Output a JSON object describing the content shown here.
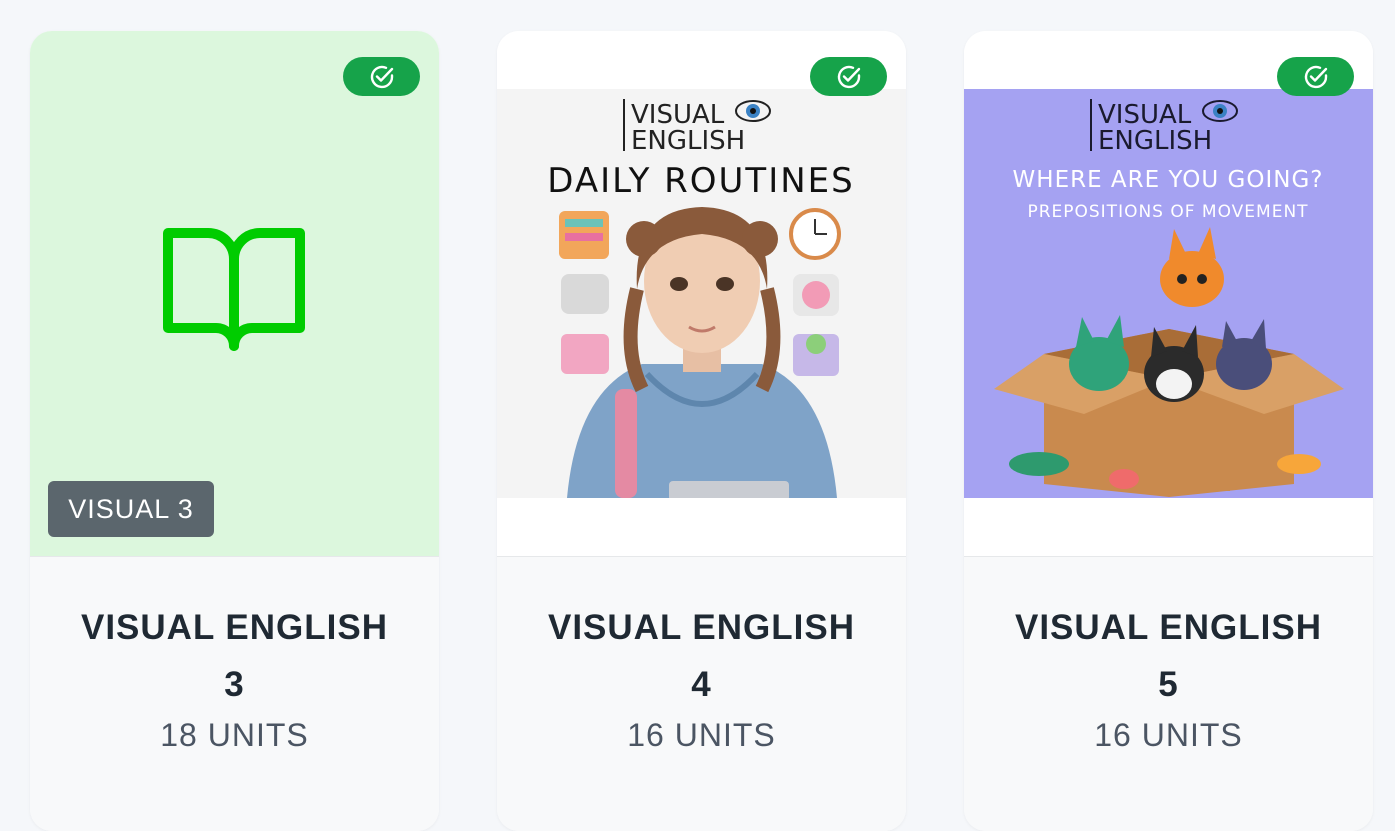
{
  "courses": [
    {
      "title_line1": "VISUAL ENGLISH",
      "title_line2": "3",
      "units": "18 UNITS",
      "badge": "VISUAL 3",
      "completed": true
    },
    {
      "title_line1": "VISUAL ENGLISH",
      "title_line2": "4",
      "units": "16 UNITS",
      "cover": {
        "brand_line1": "VISUAL",
        "brand_line2": "ENGLISH",
        "heading": "DAILY ROUTINES"
      },
      "completed": true
    },
    {
      "title_line1": "VISUAL ENGLISH",
      "title_line2": "5",
      "units": "16 UNITS",
      "cover": {
        "brand_line1": "VISUAL",
        "brand_line2": "ENGLISH",
        "heading": "WHERE ARE YOU GOING?",
        "subheading": "PREPOSITIONS OF MOVEMENT"
      },
      "completed": true
    }
  ],
  "colors": {
    "accent_green": "#16a34a",
    "icon_green": "#00cc00",
    "card1_bg": "#dcf7dd",
    "cover3_bg": "#a5a2f2"
  }
}
